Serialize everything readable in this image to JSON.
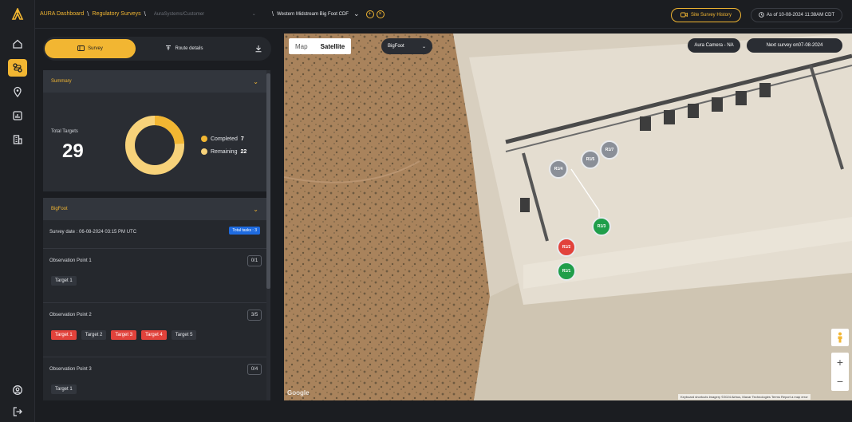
{
  "topbar": {
    "crumb_1": "AURA Dashboard",
    "crumb_2": "Regulatory Surveys",
    "customer_placeholder": "AuraSystems/Customer",
    "site": "Western Midstream Big Foot CDF",
    "history_label": "Site Survey History",
    "as_of": "As of 10-08-2024 11:38AM CDT"
  },
  "panel": {
    "tab_survey": "Survey",
    "tab_route": "Route details",
    "summary": {
      "header": "Summary",
      "total_label": "Total Targets",
      "total_value": "29",
      "completed_label": "Completed",
      "completed_value": "7",
      "remaining_label": "Remaining",
      "remaining_value": "22",
      "completed_fraction": 0.24
    },
    "bigfoot": {
      "header": "BigFoot",
      "survey_date": "Survey date : 06-08-2024 03:15 PM UTC",
      "total_tasks": "Total tasks : 3"
    },
    "observation_points": [
      {
        "title": "Observation Point 1",
        "count": "0/1",
        "targets": [
          {
            "label": "Target 1",
            "state": "neutral"
          }
        ]
      },
      {
        "title": "Observation Point 2",
        "count": "3/5",
        "targets": [
          {
            "label": "Target 1",
            "state": "failed"
          },
          {
            "label": "Target 2",
            "state": "neutral"
          },
          {
            "label": "Target 3",
            "state": "failed"
          },
          {
            "label": "Target 4",
            "state": "failed"
          },
          {
            "label": "Target 5",
            "state": "neutral"
          }
        ]
      },
      {
        "title": "Observation Point 3",
        "count": "0/4",
        "targets": [
          {
            "label": "Target 1",
            "state": "neutral"
          }
        ]
      }
    ]
  },
  "map": {
    "map_option": "Map",
    "satellite_option": "Satellite",
    "site_filter": "BigFoot",
    "camera_pill": "Aura Camera - NA",
    "next_survey": "Next survey on07-08-2024",
    "google_label": "Google",
    "attribution": "Keyboard shortcuts   Imagery ©2024 Airbus, Maxar Technologies   Terms   Report a map error",
    "zoom_in": "+",
    "zoom_out": "−",
    "markers": [
      {
        "label": "R1/4",
        "state": "grey"
      },
      {
        "label": "R1/5",
        "state": "grey"
      },
      {
        "label": "R1/7",
        "state": "grey"
      },
      {
        "label": "R1/3",
        "state": "green"
      },
      {
        "label": "R1/2",
        "state": "red"
      },
      {
        "label": "R1/1",
        "state": "green"
      }
    ]
  },
  "colors": {
    "accent": "#f2b632",
    "completed": "#f2b632",
    "remaining": "#f7d27a",
    "failed": "#e2423b",
    "passed": "#1f9e4a",
    "pending": "#8a8f98"
  },
  "icons": [
    "aura-logo-icon",
    "home-icon",
    "route-icon",
    "location-pin-icon",
    "report-icon",
    "building-icon",
    "user-icon",
    "logout-icon",
    "chevron-down-icon",
    "download-icon",
    "camera-icon",
    "clock-icon",
    "pegman-icon"
  ]
}
